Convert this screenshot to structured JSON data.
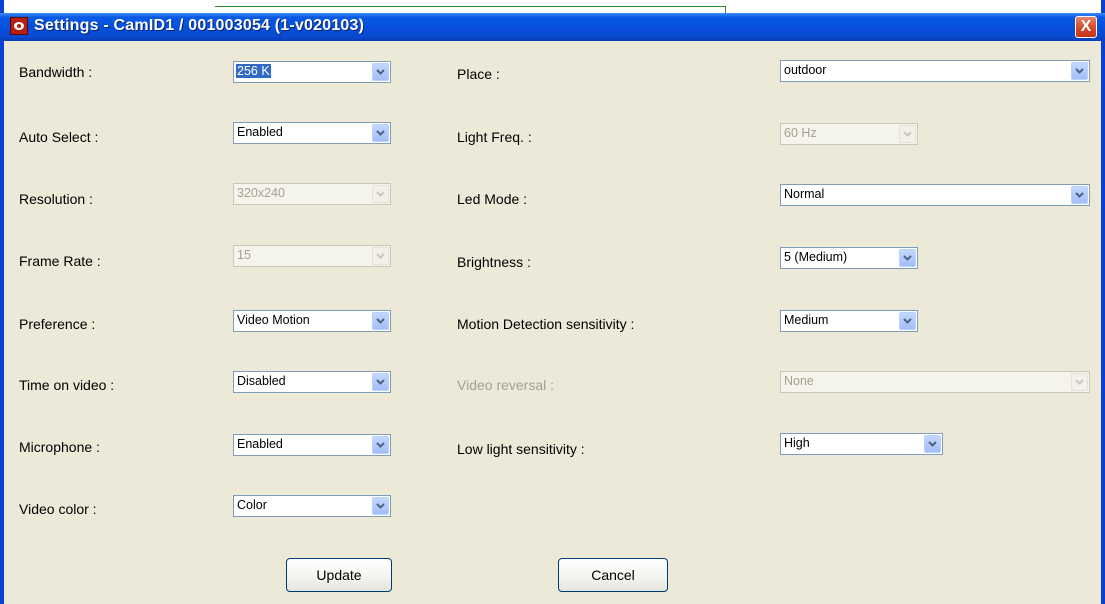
{
  "window": {
    "title": "Settings - CamID1 / 001003054 (1-v020103)",
    "close_glyph": "X"
  },
  "left": [
    {
      "label": "Bandwidth :",
      "value": "256 K",
      "disabled": false,
      "selected": true
    },
    {
      "label": "Auto Select :",
      "value": "Enabled",
      "disabled": false
    },
    {
      "label": "Resolution :",
      "value": "320x240",
      "disabled": true
    },
    {
      "label": "Frame Rate :",
      "value": "15",
      "disabled": true
    },
    {
      "label": "Preference :",
      "value": "Video Motion",
      "disabled": false
    },
    {
      "label": "Time on video :",
      "value": "Disabled",
      "disabled": false
    },
    {
      "label": "Microphone :",
      "value": "Enabled",
      "disabled": false
    },
    {
      "label": "Video color :",
      "value": "Color",
      "disabled": false
    }
  ],
  "right": [
    {
      "label": "Place :",
      "value": "outdoor",
      "disabled": false
    },
    {
      "label": "Light Freq. :",
      "value": "60 Hz",
      "disabled": true
    },
    {
      "label": "Led Mode :",
      "value": "Normal",
      "disabled": false
    },
    {
      "label": "Brightness :",
      "value": "5 (Medium)",
      "disabled": false
    },
    {
      "label": "Motion Detection sensitivity :",
      "value": "Medium",
      "disabled": false
    },
    {
      "label": "Video reversal :",
      "value": "None",
      "disabled": true,
      "label_disabled": true
    },
    {
      "label": "Low light sensitivity :",
      "value": "High",
      "disabled": false
    }
  ],
  "buttons": {
    "update": "Update",
    "cancel": "Cancel"
  },
  "colors": {
    "titlebar": "#0550dc",
    "dialog_bg": "#ece9d8",
    "close": "#d44a2c"
  }
}
